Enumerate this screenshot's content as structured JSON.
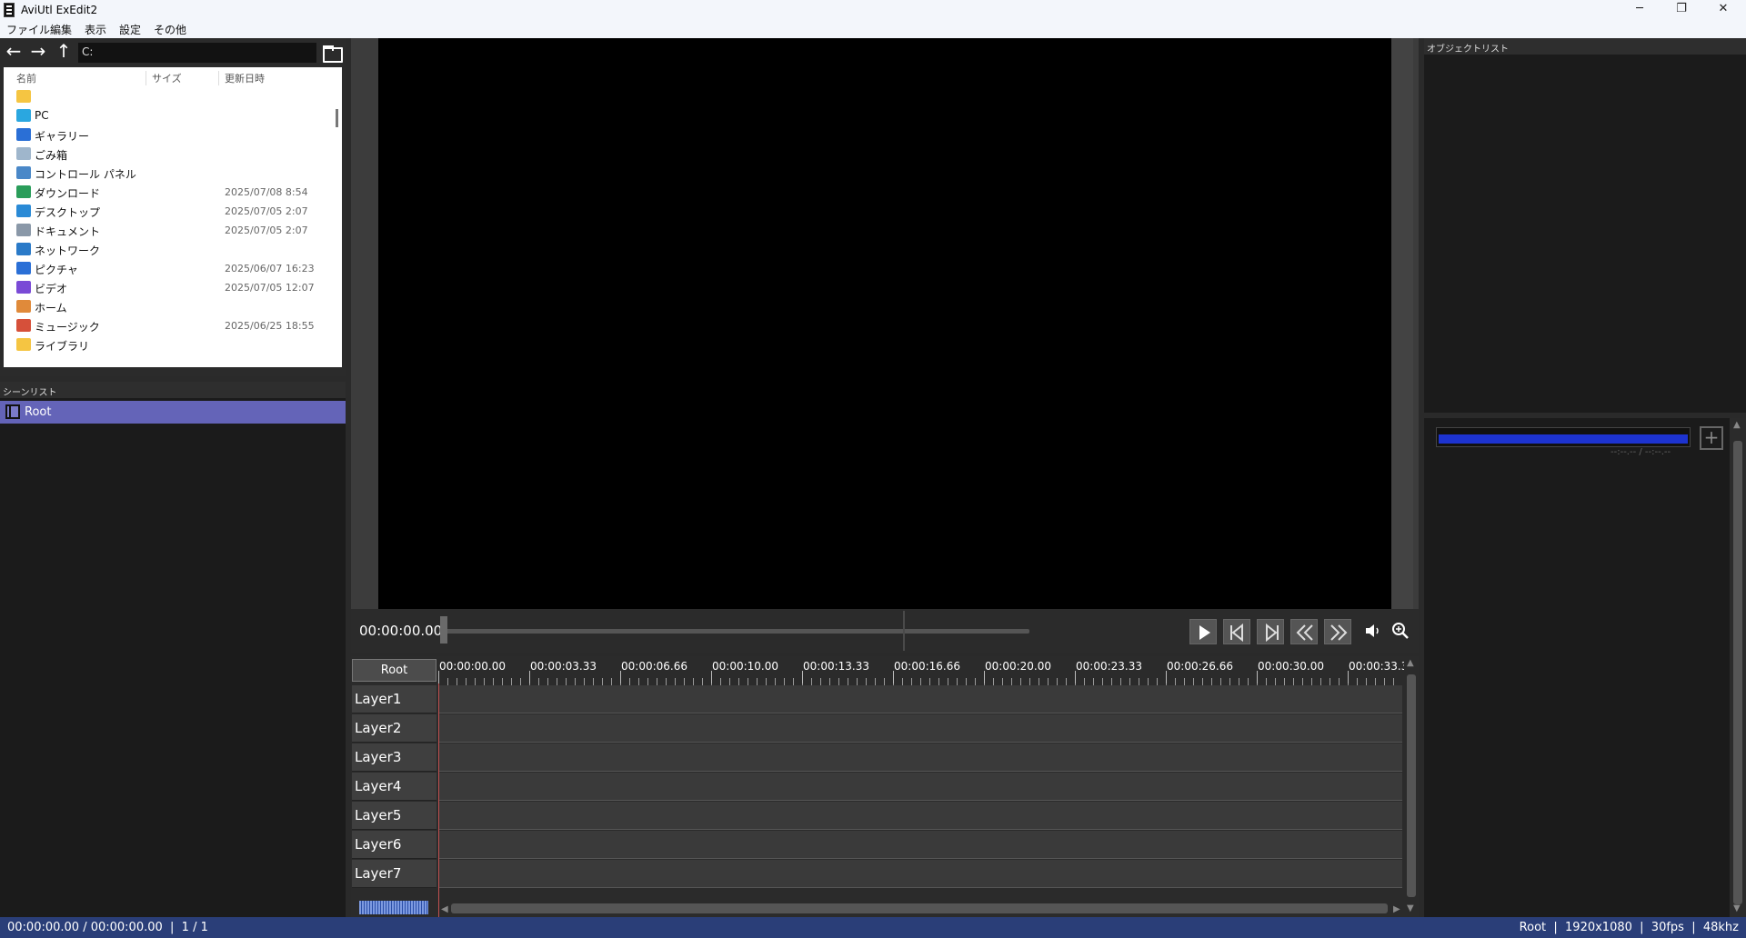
{
  "window": {
    "title": "AviUtl ExEdit2",
    "minimize": "─",
    "restore": "❐",
    "close": "✕"
  },
  "menu": [
    "ファイル",
    "編集",
    "表示",
    "設定",
    "その他"
  ],
  "explorer": {
    "path": "C:",
    "columns": {
      "name": "名前",
      "size": "サイズ",
      "modified": "更新日時"
    },
    "items": [
      {
        "name": "",
        "date": "",
        "icon": "folder-icon",
        "color": "#f5c542"
      },
      {
        "name": "PC",
        "date": "",
        "icon": "pc-icon",
        "color": "#2aa7e0"
      },
      {
        "name": "ギャラリー",
        "date": "",
        "icon": "gallery-icon",
        "color": "#2a6fd6"
      },
      {
        "name": "ごみ箱",
        "date": "",
        "icon": "recycle-bin-icon",
        "color": "#9fb6cc"
      },
      {
        "name": "コントロール パネル",
        "date": "",
        "icon": "control-panel-icon",
        "color": "#4a88c8"
      },
      {
        "name": "ダウンロード",
        "date": "2025/07/08 8:54",
        "icon": "download-icon",
        "color": "#2a9d5a"
      },
      {
        "name": "デスクトップ",
        "date": "2025/07/05 2:07",
        "icon": "desktop-icon",
        "color": "#2a8ad6"
      },
      {
        "name": "ドキュメント",
        "date": "2025/07/05 2:07",
        "icon": "document-icon",
        "color": "#8a98a8"
      },
      {
        "name": "ネットワーク",
        "date": "",
        "icon": "network-icon",
        "color": "#2a7ac8"
      },
      {
        "name": "ピクチャ",
        "date": "2025/06/07 16:23",
        "icon": "pictures-icon",
        "color": "#2a6fd6"
      },
      {
        "name": "ビデオ",
        "date": "2025/07/05 12:07",
        "icon": "videos-icon",
        "color": "#7a4ad6"
      },
      {
        "name": "ホーム",
        "date": "",
        "icon": "home-icon",
        "color": "#e08a3a"
      },
      {
        "name": "ミュージック",
        "date": "2025/06/25 18:55",
        "icon": "music-icon",
        "color": "#d6503a"
      },
      {
        "name": "ライブラリ",
        "date": "",
        "icon": "library-icon",
        "color": "#f5c542"
      }
    ]
  },
  "scenes": {
    "header": "シーンリスト",
    "items": [
      "Root"
    ]
  },
  "objectList": {
    "header": "オブジェクトリスト"
  },
  "properties": {
    "time": "--:--.-- / --:--.--",
    "add": "+"
  },
  "transport": {
    "time": "00:00:00.00"
  },
  "timeline": {
    "scene_button": "Root",
    "ticks": [
      "00:00:00.00",
      "00:00:03.33",
      "00:00:06.66",
      "00:00:10.00",
      "00:00:13.33",
      "00:00:16.66",
      "00:00:20.00",
      "00:00:23.33",
      "00:00:26.66",
      "00:00:30.00",
      "00:00:33.3"
    ],
    "layers": [
      "Layer1",
      "Layer2",
      "Layer3",
      "Layer4",
      "Layer5",
      "Layer6",
      "Layer7"
    ]
  },
  "status": {
    "left": "00:00:00.00 / 00:00:00.00  |  1 / 1",
    "right": "Root  |  1920x1080  |  30fps  |  48khz"
  },
  "colors": {
    "accent": "#6464b8",
    "status_bar": "#2a3e78",
    "playhead": "#c05050"
  }
}
